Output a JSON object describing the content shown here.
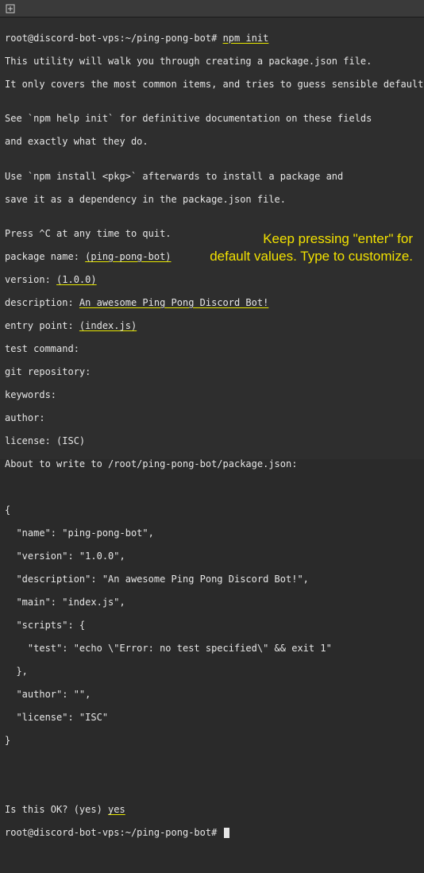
{
  "titlebar": {
    "icon": "new-tab"
  },
  "prompt": {
    "user": "root@discord-bot-vps",
    "path": "~/ping-pong-bot",
    "marker": "#"
  },
  "command": "npm init",
  "output": {
    "l1": "This utility will walk you through creating a package.json file.",
    "l2": "It only covers the most common items, and tries to guess sensible defaults.",
    "l3": "",
    "l4": "See `npm help init` for definitive documentation on these fields",
    "l5": "and exactly what they do.",
    "l6": "",
    "l7": "Use `npm install <pkg>` afterwards to install a package and",
    "l8": "save it as a dependency in the package.json file.",
    "l9": "",
    "l10": "Press ^C at any time to quit."
  },
  "prompts": {
    "pkg_label": "package name: ",
    "pkg_default": "(ping-pong-bot)",
    "ver_label": "version: ",
    "ver_default": "(1.0.0)",
    "desc_label": "description: ",
    "desc_value": "An awesome Ping Pong Discord Bot!",
    "entry_label": "entry point: ",
    "entry_default": "(index.js)",
    "test_label": "test command:",
    "git_label": "git repository:",
    "keywords_label": "keywords:",
    "author_label": "author:",
    "license_label": "license: (ISC)",
    "about_label": "About to write to /root/ping-pong-bot/package.json:"
  },
  "json_preview": {
    "l0": "{",
    "l1": "  \"name\": \"ping-pong-bot\",",
    "l2": "  \"version\": \"1.0.0\",",
    "l3": "  \"description\": \"An awesome Ping Pong Discord Bot!\",",
    "l4": "  \"main\": \"index.js\",",
    "l5": "  \"scripts\": {",
    "l6": "    \"test\": \"echo \\\"Error: no test specified\\\" && exit 1\"",
    "l7": "  },",
    "l8": "  \"author\": \"\",",
    "l9": "  \"license\": \"ISC\"",
    "l10": "}"
  },
  "confirm": {
    "label": "Is this OK? (yes) ",
    "value": "yes"
  },
  "annotation": {
    "line1": "Keep pressing \"enter\" for",
    "line2": "default values. Type to customize."
  }
}
